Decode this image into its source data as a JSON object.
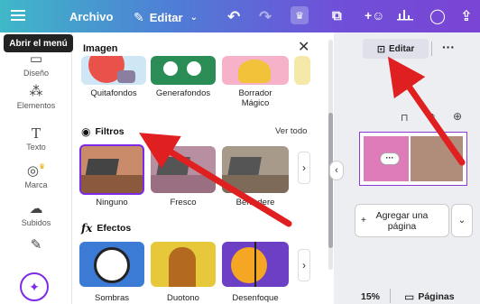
{
  "topbar": {
    "archivo": "Archivo",
    "editar": "Editar",
    "tooltip": "Abrir el menú"
  },
  "leftnav": {
    "items": [
      {
        "label": "Diseño",
        "icon": "layout-icon"
      },
      {
        "label": "Elementos",
        "icon": "elements-icon"
      },
      {
        "label": "Texto",
        "icon": "text-icon"
      },
      {
        "label": "Marca",
        "icon": "brand-icon"
      },
      {
        "label": "Subidos",
        "icon": "cloud-icon"
      }
    ]
  },
  "panel": {
    "title": "Imagen",
    "tools": [
      "Quitafondos",
      "Generafondos",
      "Borrador",
      "Mágico"
    ],
    "filtros": {
      "title": "Filtros",
      "ver_todo": "Ver todo",
      "items": [
        "Ninguno",
        "Fresco",
        "Belvedere"
      ]
    },
    "efectos": {
      "title": "Efectos",
      "items": [
        "Sombras",
        "Duotono",
        "Desenfoque"
      ]
    }
  },
  "right": {
    "edit_label": "Editar",
    "add_page": [
      "Agregar una",
      "página"
    ],
    "zoom": "15%",
    "pages_label": "Páginas"
  },
  "colors": {
    "accent": "#7d2ae8",
    "arrow": "#e02020"
  }
}
